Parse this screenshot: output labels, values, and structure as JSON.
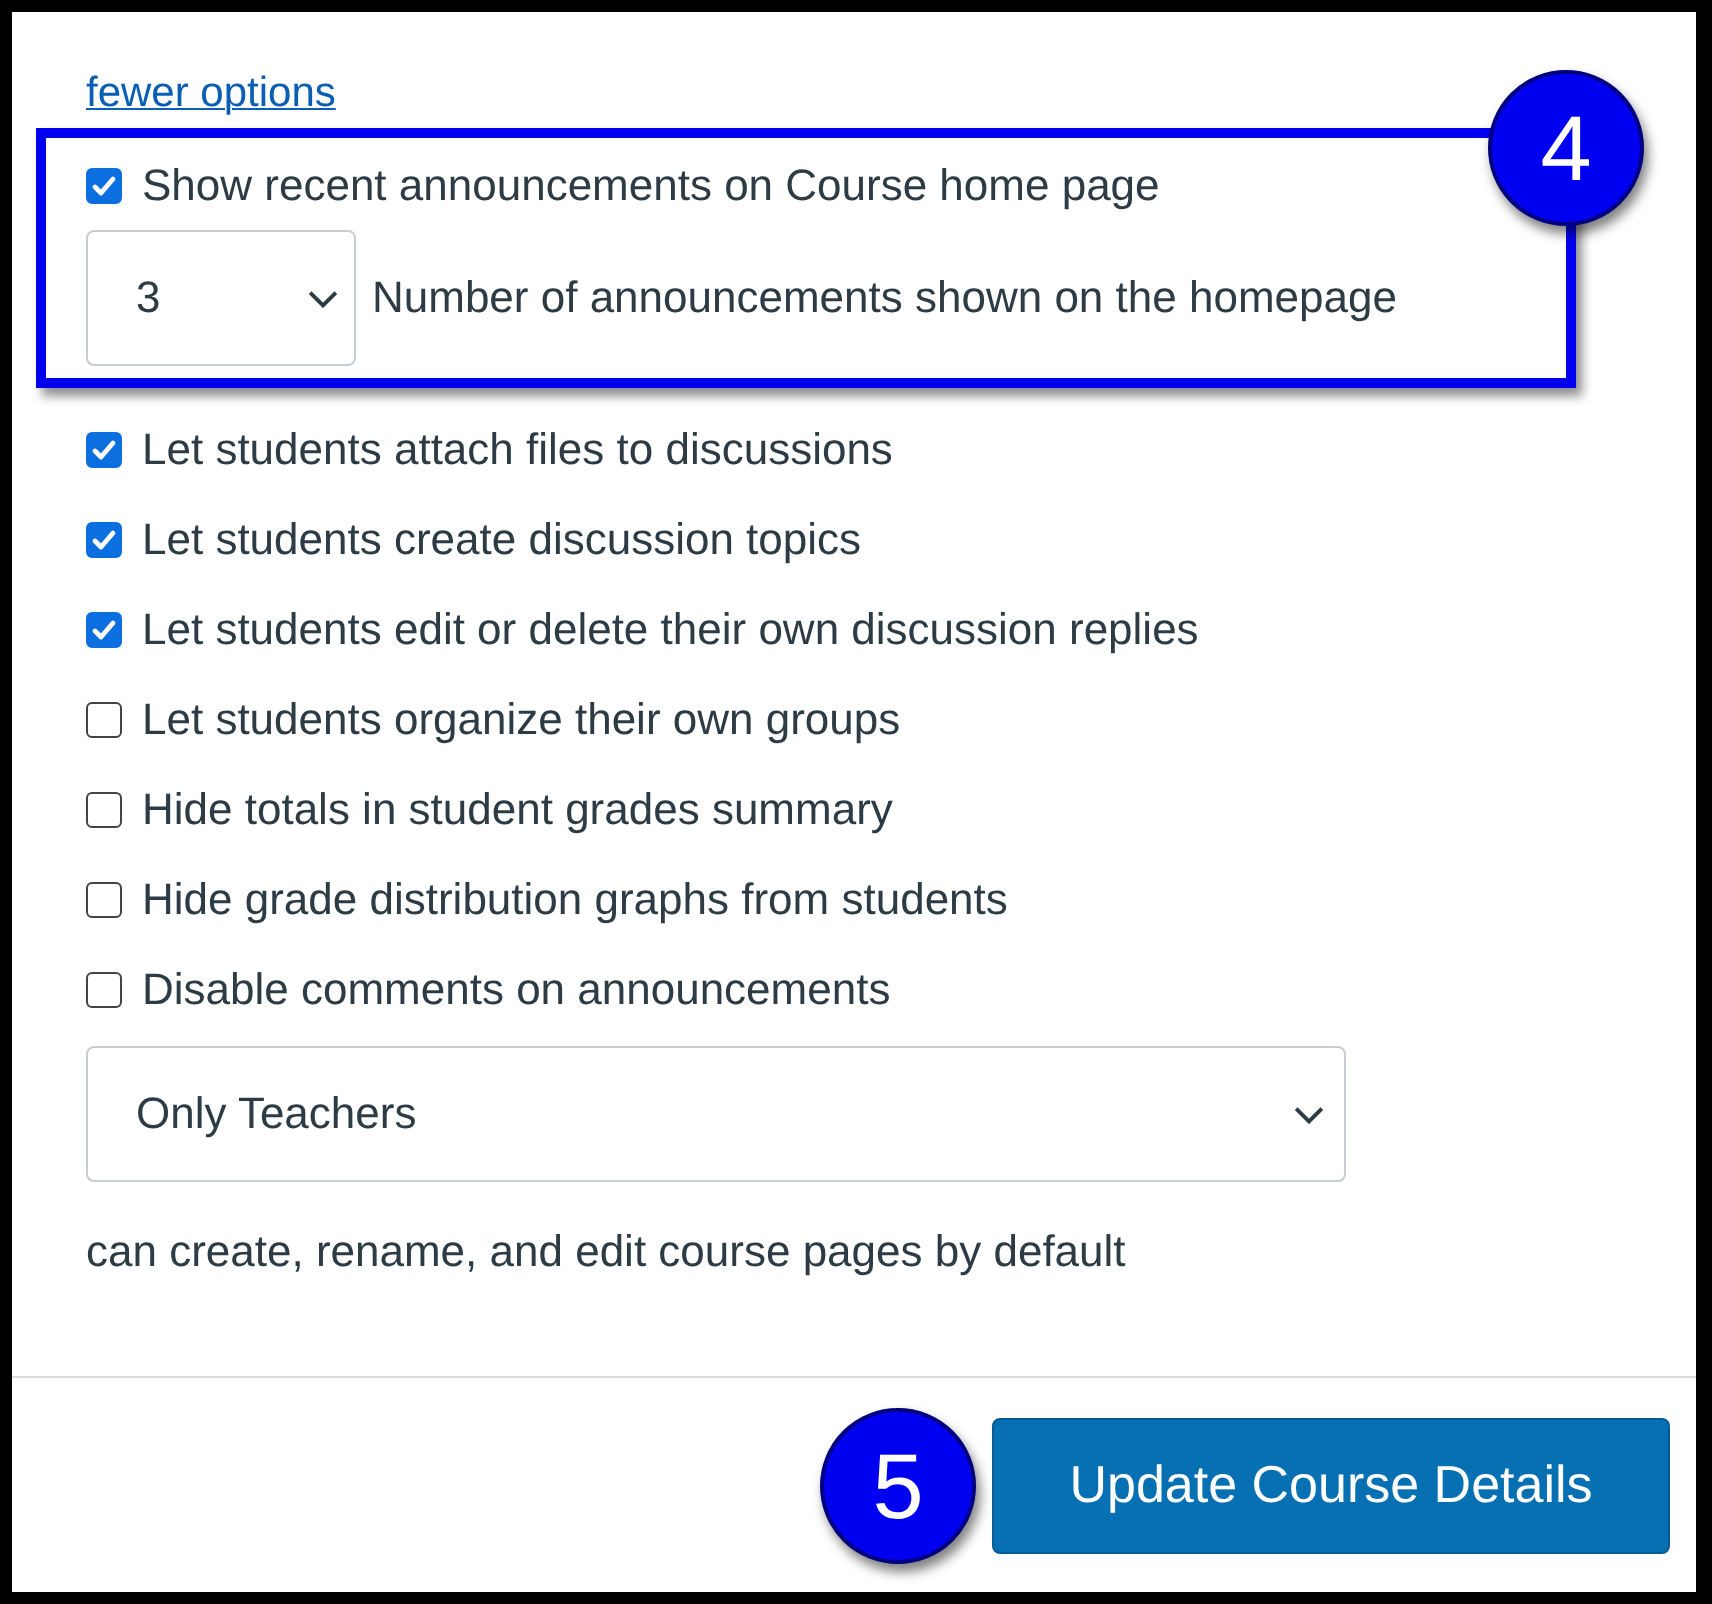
{
  "more_options_link": "fewer options",
  "highlighted_group": {
    "callout": "4",
    "announcements_option": {
      "label": "Show recent announcements on Course home page",
      "checked": true
    },
    "announcement_count": {
      "value": "3",
      "label": "Number of announcements shown on the homepage"
    }
  },
  "options": [
    {
      "label": "Let students attach files to discussions",
      "checked": true
    },
    {
      "label": "Let students create discussion topics",
      "checked": true
    },
    {
      "label": "Let students edit or delete their own discussion replies",
      "checked": true
    },
    {
      "label": "Let students organize their own groups",
      "checked": false
    },
    {
      "label": "Hide totals in student grades summary",
      "checked": false
    },
    {
      "label": "Hide grade distribution graphs from students",
      "checked": false
    },
    {
      "label": "Disable comments on announcements",
      "checked": false
    }
  ],
  "pages_permission": {
    "value": "Only Teachers",
    "caption": "can create, rename, and edit course pages by default"
  },
  "footer": {
    "callout": "5",
    "button": "Update Course Details"
  }
}
